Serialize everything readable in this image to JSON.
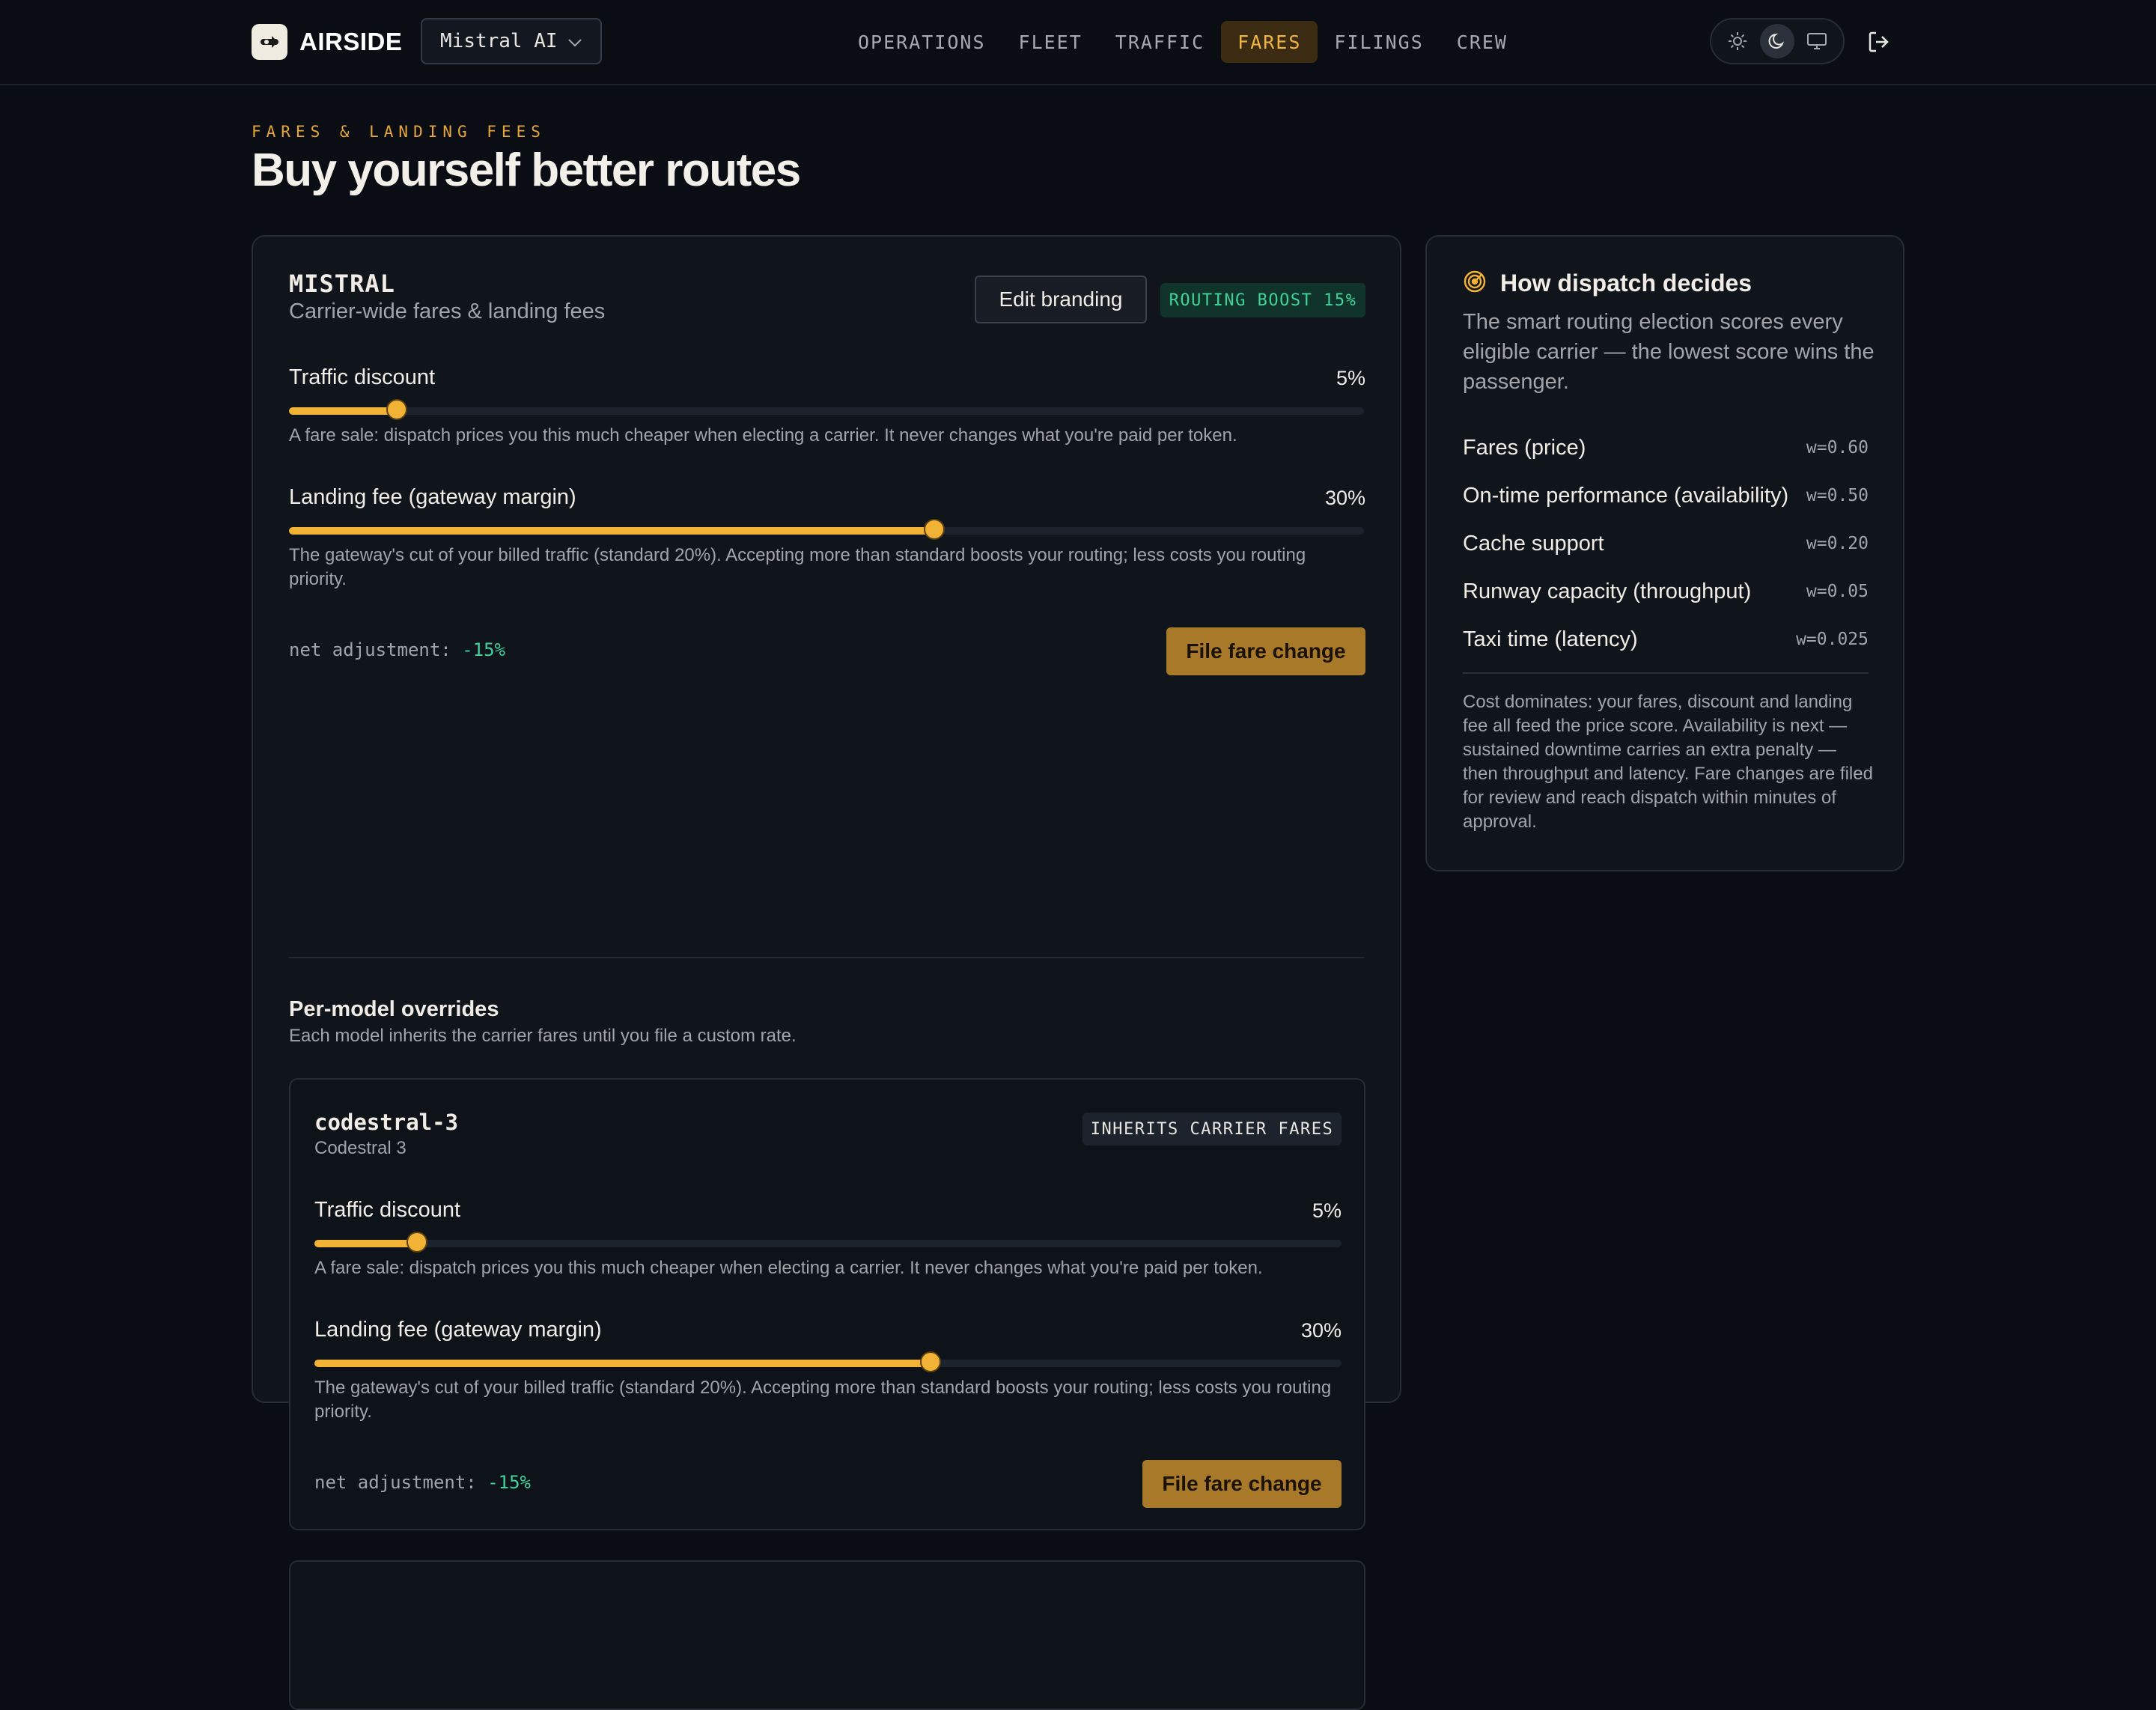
{
  "header": {
    "brand": "AIRSIDE",
    "org_select": "Mistral AI",
    "nav": [
      "OPERATIONS",
      "FLEET",
      "TRAFFIC",
      "FARES",
      "FILINGS",
      "CREW"
    ],
    "active_nav": "FARES",
    "theme_options": [
      "sun-icon",
      "moon-icon",
      "monitor-icon"
    ],
    "active_theme": "moon-icon"
  },
  "page": {
    "eyebrow": "FARES & LANDING FEES",
    "title": "Buy yourself better routes"
  },
  "carrier": {
    "code": "MISTRAL",
    "subtitle": "Carrier-wide fares & landing fees",
    "edit_button": "Edit branding",
    "boost_badge": "ROUTING BOOST 15%",
    "traffic_discount": {
      "label": "Traffic discount",
      "value_text": "5%",
      "percent": 5,
      "help": "A fare sale: dispatch prices you this much cheaper when electing a carrier. It never changes what you're paid per token."
    },
    "landing_fee": {
      "label": "Landing fee (gateway margin)",
      "value_text": "30%",
      "percent": 30,
      "help": "The gateway's cut of your billed traffic (standard 20%). Accepting more than standard boosts your routing; less costs you routing priority."
    },
    "net_label": "net adjustment:",
    "net_value": "-15%",
    "file_button": "File fare change"
  },
  "overrides": {
    "title": "Per-model overrides",
    "subtitle": "Each model inherits the carrier fares until you file a custom rate.",
    "models": [
      {
        "id": "codestral-3",
        "name": "Codestral 3",
        "badge": "INHERITS CARRIER FARES",
        "traffic_discount": {
          "label": "Traffic discount",
          "value_text": "5%",
          "percent": 5,
          "help": "A fare sale: dispatch prices you this much cheaper when electing a carrier. It never changes what you're paid per token."
        },
        "landing_fee": {
          "label": "Landing fee (gateway margin)",
          "value_text": "30%",
          "percent": 30,
          "help": "The gateway's cut of your billed traffic (standard 20%). Accepting more than standard boosts your routing; less costs you routing priority."
        },
        "net_label": "net adjustment:",
        "net_value": "-15%",
        "file_button": "File fare change"
      }
    ]
  },
  "dispatch": {
    "title": "How dispatch decides",
    "description": "The smart routing election scores every eligible carrier — the lowest score wins the passenger.",
    "weights": [
      {
        "label": "Fares (price)",
        "value": "w=0.60"
      },
      {
        "label": "On-time performance (availability)",
        "value": "w=0.50"
      },
      {
        "label": "Cache support",
        "value": "w=0.20"
      },
      {
        "label": "Runway capacity (throughput)",
        "value": "w=0.05"
      },
      {
        "label": "Taxi time (latency)",
        "value": "w=0.025"
      }
    ],
    "note": "Cost dominates: your fares, discount and landing fee all feed the price score. Availability is next — sustained downtime carries an extra penalty — then throughput and latency. Fare changes are filed for review and reach dispatch within minutes of approval."
  },
  "colors": {
    "accent": "#f2b236",
    "positive": "#3fd39a",
    "background": "#0a0e14"
  }
}
